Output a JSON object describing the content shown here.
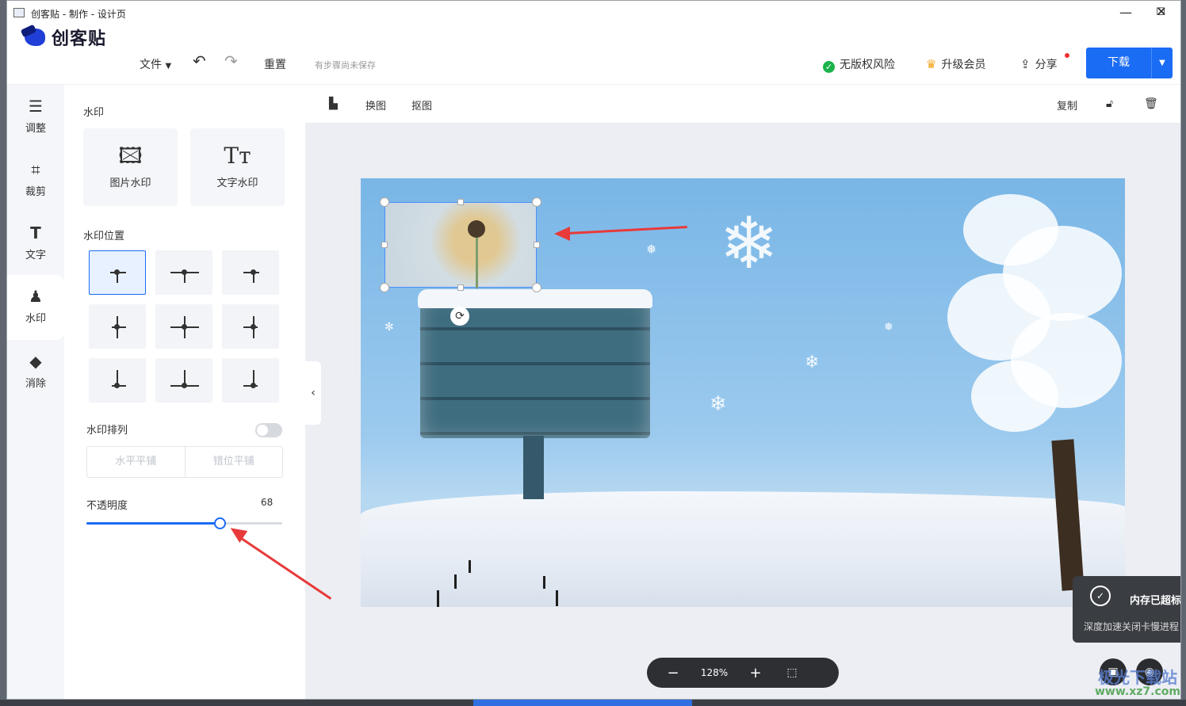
{
  "window": {
    "title": "创客贴 - 制作 - 设计页"
  },
  "header": {
    "logo_text": "创客贴",
    "file_menu": "文件",
    "reset": "重置",
    "save_status": "有步骤尚未保存",
    "no_copyright": "无版权风险",
    "upgrade": "升级会员",
    "share": "分享",
    "download": "下载"
  },
  "sidebar": {
    "items": [
      {
        "label": "调整",
        "icon": "sliders-icon"
      },
      {
        "label": "裁剪",
        "icon": "crop-icon"
      },
      {
        "label": "文字",
        "icon": "text-icon"
      },
      {
        "label": "水印",
        "icon": "stamp-icon"
      },
      {
        "label": "消除",
        "icon": "eraser-icon"
      }
    ],
    "active_index": 3
  },
  "panel": {
    "watermark_title": "水印",
    "image_watermark": "图片水印",
    "text_watermark": "文字水印",
    "position_title": "水印位置",
    "position_selected": "top-left",
    "arrange_title": "水印排列",
    "arrange_enabled": false,
    "tile_horizontal": "水平平铺",
    "tile_staggered": "错位平铺",
    "opacity_label": "不透明度",
    "opacity_value": "68",
    "opacity_fraction": 0.68
  },
  "toolbar": {
    "replace": "换图",
    "cutout": "抠图",
    "copy": "复制"
  },
  "zoom": {
    "value": "128%"
  },
  "toast": {
    "title": "内存已超标,",
    "message": "深度加速关闭卡慢进程"
  },
  "site_watermark": {
    "text": "极光下载站",
    "url": "www.xz7.com"
  },
  "colors": {
    "accent": "#1a6cf5",
    "arrow": "#e83a3a",
    "ok_green": "#1bb34a"
  }
}
